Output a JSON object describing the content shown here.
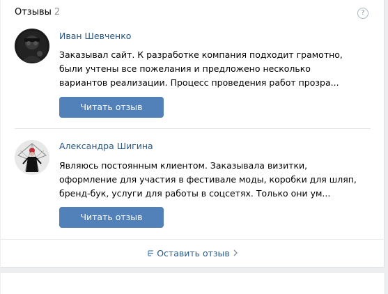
{
  "header": {
    "title": "Отзывы",
    "count": "2",
    "help_label": "?"
  },
  "reviews": [
    {
      "author": "Иван Шевченко",
      "text": "Заказывал сайт. К разработке компания подходит грамотно, были учтены все пожелания и предложено несколько вариантов реализации. Процесс проведения работ прозра...",
      "button": "Читать отзыв"
    },
    {
      "author": "Александра Шигина",
      "text": "Являюсь постоянным клиентом. Заказывала визитки, оформление для участия в фестивале моды, коробки для шляп, бренд-бук, услуги для работы в соцсетях. Только они ум...",
      "button": "Читать отзыв"
    }
  ],
  "footer": {
    "leave_review": "Оставить отзыв",
    "icon": "review-icon",
    "chevron": "chevron-right-icon"
  },
  "colors": {
    "accent": "#5181b8",
    "link": "#2a5885",
    "background": "#edeef0"
  }
}
